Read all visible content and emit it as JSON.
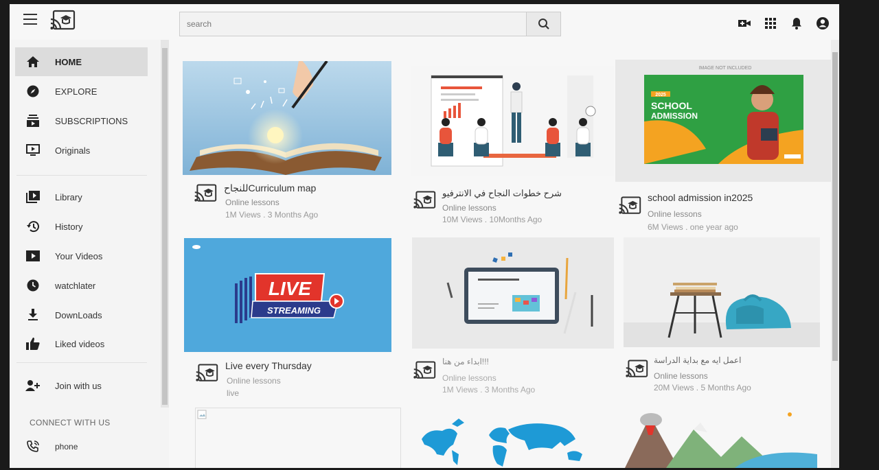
{
  "header": {
    "search_placeholder": "search"
  },
  "sidebar": {
    "items": [
      {
        "label": "HOME",
        "icon": "home-icon",
        "active": true
      },
      {
        "label": "EXPLORE",
        "icon": "compass-icon"
      },
      {
        "label": "SUBSCRIPTIONS",
        "icon": "subscriptions-icon"
      },
      {
        "label": "Originals",
        "icon": "originals-icon"
      },
      {
        "label": "Library",
        "icon": "library-icon"
      },
      {
        "label": "History",
        "icon": "history-icon"
      },
      {
        "label": "Your Videos",
        "icon": "your-videos-icon"
      },
      {
        "label": "watchlater",
        "icon": "clock-icon"
      },
      {
        "label": "DownLoads",
        "icon": "download-icon"
      },
      {
        "label": "Liked videos",
        "icon": "thumbs-up-icon"
      },
      {
        "label": "Join with us",
        "icon": "add-user-icon"
      }
    ],
    "connect_label": "CONNECT WITH US",
    "connect_items": [
      {
        "label": "phone",
        "icon": "phone-icon"
      }
    ]
  },
  "videos": [
    {
      "title": "للنجاحCurriculum map",
      "channel": "Online lessons",
      "stats": "1M Views . 3 Months Ago",
      "thumb": "book-lightbulb-illustration"
    },
    {
      "title": "شرح خطوات النجاح في الانترفيو",
      "channel": "Online lessons",
      "stats": "10M Views . 10Months Ago",
      "thumb": "presentation-illustration"
    },
    {
      "title": "school admission in2025",
      "channel": "Online lessons",
      "stats": "6M Views . one year ago",
      "thumb": "school-admission-flyer",
      "flyer": {
        "top_note": "IMAGE NOT INCLUDED",
        "year": "2025",
        "line1": "SCHOOL",
        "line2": "ADMISSION"
      }
    },
    {
      "title": "Live every Thursday",
      "channel": "Online lessons",
      "stats": "live",
      "thumb": "live-streaming-banner",
      "banner": {
        "line1": "LIVE",
        "line2": "STREAMING"
      }
    },
    {
      "title": "ابداء من هنا!!!",
      "channel": "Online lessons",
      "stats": "1M Views . 3 Months Ago",
      "thumb": "tablet-desk-illustration"
    },
    {
      "title": "اعمل ايه مع بداية الدراسة",
      "channel": "Online lessons",
      "stats": "20M Views . 5 Months Ago",
      "thumb": "desk-backpack-illustration"
    }
  ],
  "colors": {
    "live_red": "#e2342b",
    "live_blue_bg": "#4fa8dc",
    "flyer_green": "#2fa043",
    "flyer_orange": "#f4a321",
    "map_blue": "#1e9ad6"
  }
}
